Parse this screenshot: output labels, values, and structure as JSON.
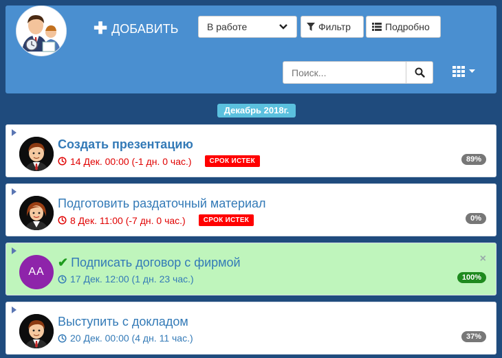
{
  "toolbar": {
    "add_label": "ДОБАВИТЬ",
    "status_selected": "В работе",
    "filter_label": "Фильтр",
    "details_label": "Подробно",
    "search_placeholder": "Поиск..."
  },
  "month_label": "Декабрь 2018г.",
  "tasks": [
    {
      "title": "Создать презентацию",
      "due": "14 Дек. 00:00 (-1 дн. 0 час.)",
      "badge": "СРОК ИСТЕК",
      "percent": "89%"
    },
    {
      "title": "Подготовить раздаточный материал",
      "due": "8 Дек. 11:00 (-7 дн. 0 час.)",
      "badge": "СРОК ИСТЕК",
      "percent": "0%"
    },
    {
      "title": "Подписать договор с фирмой",
      "due": "17 Дек. 12:00 (1 дн. 23 час.)",
      "initials": "AA",
      "percent": "100%"
    },
    {
      "title": "Выступить с докладом",
      "due": "20 Дек. 00:00 (4 дн. 11 час.)",
      "percent": "37%"
    }
  ],
  "colors": {
    "header_bg": "#4a8fd0",
    "page_bg": "#1f4b7d",
    "link_blue": "#337ab7",
    "overdue_red": "#ff0000",
    "done_bg": "#bff5bc"
  }
}
